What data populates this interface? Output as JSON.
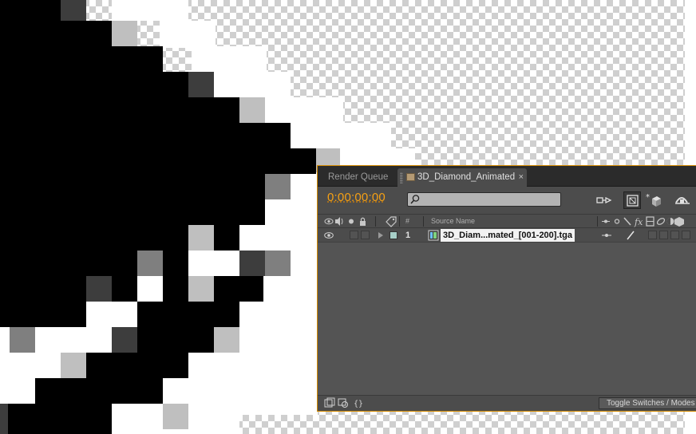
{
  "tabs": {
    "render_queue": "Render Queue",
    "composition": "3D_Diamond_Animated",
    "close_glyph": "×"
  },
  "toolbar": {
    "timecode": "0:00:00:00",
    "search_value": "",
    "icons": [
      "draft-3d-icon",
      "comp-flowchart-icon",
      "motion-blur-icon",
      "graph-editor-icon"
    ]
  },
  "columns": {
    "number": "#",
    "source_name": "Source Name",
    "fx": "fx"
  },
  "layer": {
    "number": "1",
    "name": "3D_Diam...mated_[001-200].tga",
    "label_color": "#a7cfc8"
  },
  "bottom": {
    "toggle_label": "Toggle Switches / Modes"
  },
  "colors": {
    "panel_border": "#d48a00",
    "timecode": "#f5a014",
    "panel_bg": "#4c4c4c",
    "tab_bg": "#2b2b2b"
  }
}
